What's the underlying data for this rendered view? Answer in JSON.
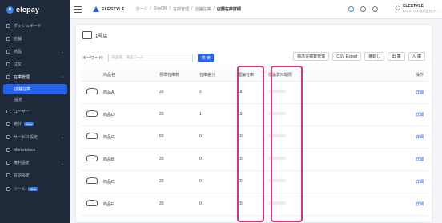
{
  "app": {
    "name": "elepay"
  },
  "sidebar": {
    "items": [
      {
        "label": "ダッシュボード",
        "chev": ""
      },
      {
        "label": "店舗",
        "chev": ""
      },
      {
        "label": "商品",
        "chev": "⌄"
      },
      {
        "label": "注文",
        "chev": ""
      },
      {
        "label": "在庫管理",
        "chev": "⌃"
      },
      {
        "label": "店舗在庫",
        "sub": true,
        "active": true
      },
      {
        "label": "設定",
        "sub": true
      },
      {
        "label": "ユーザー",
        "chev": ""
      },
      {
        "label": "統計",
        "badge": "New"
      },
      {
        "label": "サービス設定",
        "chev": "⌄"
      },
      {
        "label": "Marketplace",
        "chev": ""
      },
      {
        "label": "権利設定",
        "chev": "⌄"
      },
      {
        "label": "言語設定",
        "chev": ""
      },
      {
        "label": "ツール",
        "badge": "New"
      }
    ]
  },
  "topbar": {
    "brand": "ELESTYLE",
    "breadcrumbs": [
      "ホーム",
      "/",
      "OneQR",
      "/",
      "在庫管理",
      "/",
      "店舗在庫",
      "/"
    ],
    "current": "店舗在庫詳細",
    "user_name": "ELESTYLE",
    "user_company": "ELESTYLE株式会社(テ..."
  },
  "store": {
    "name": "1号店"
  },
  "toolbar": {
    "keyword_label": "キーワード:",
    "keyword_placeholder": "商品名、商品コード",
    "search_label": "検 索",
    "buttons": [
      "標準在庫数管理",
      "CSV Export",
      "棚卸し",
      "出 庫",
      "入 庫"
    ]
  },
  "table": {
    "headers": [
      "商品名",
      "標準在庫数",
      "在庫差分",
      "理論在庫",
      "理論賞味期限",
      "操作"
    ],
    "rows": [
      {
        "name": "商品A",
        "std": "20",
        "diff": "2",
        "theo": "18",
        "op": "詳細"
      },
      {
        "name": "商品D",
        "std": "20",
        "diff": "1",
        "theo": "19",
        "op": "詳細"
      },
      {
        "name": "商品G",
        "std": "50",
        "diff": "0",
        "theo": "50",
        "op": "詳細"
      },
      {
        "name": "商品B",
        "std": "20",
        "diff": "0",
        "theo": "20",
        "op": "詳細"
      },
      {
        "name": "商品C",
        "std": "20",
        "diff": "0",
        "theo": "20",
        "op": "詳細"
      },
      {
        "name": "商品E",
        "std": "20",
        "diff": "0",
        "theo": "20",
        "op": "詳細"
      }
    ]
  },
  "colors": {
    "accent": "#2563eb",
    "highlight": "#d6337a",
    "sidebar": "#1e2a3a"
  }
}
